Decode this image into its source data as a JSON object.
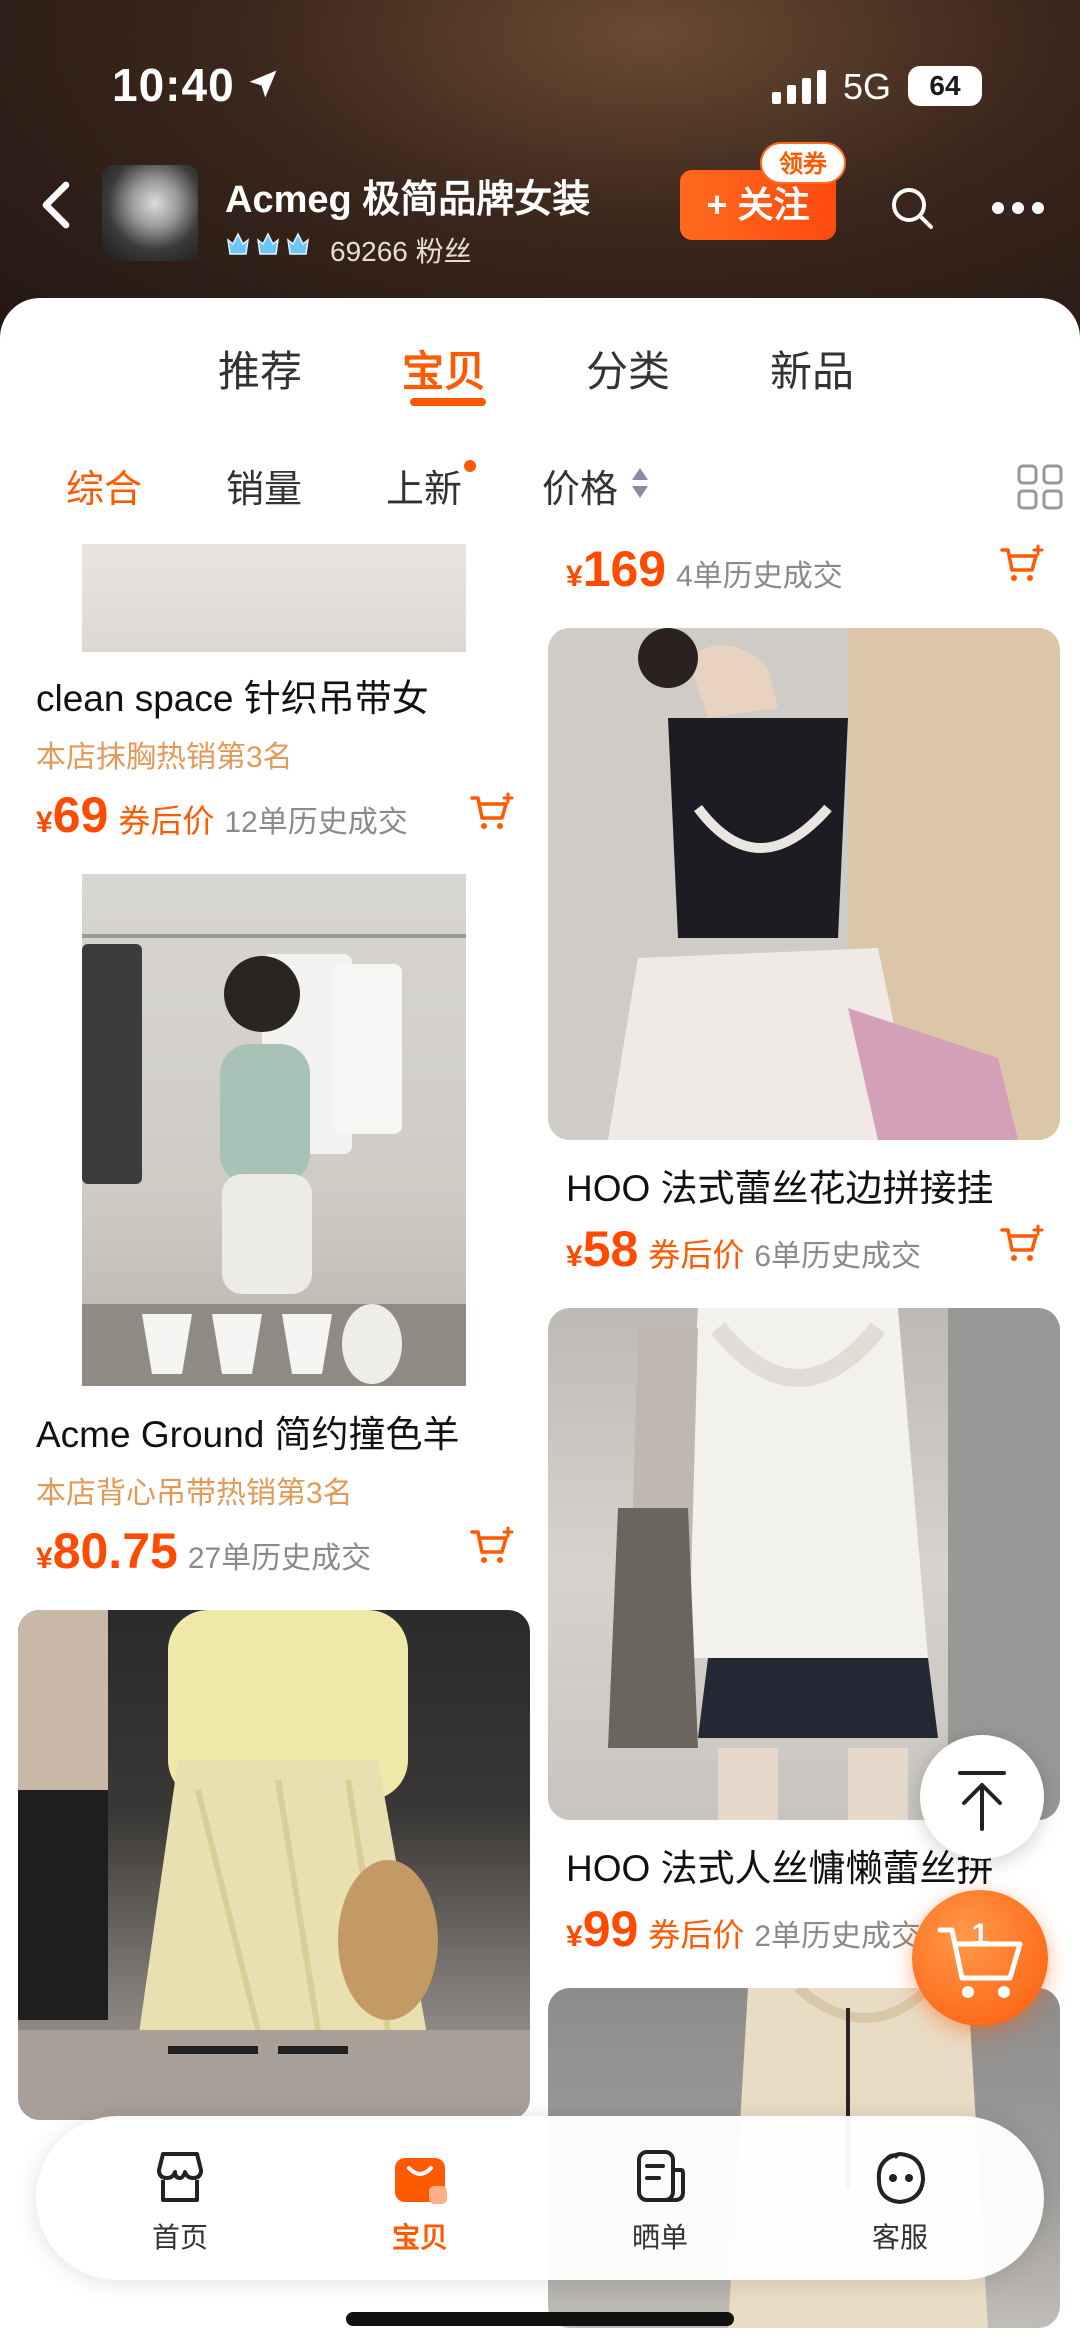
{
  "status_bar": {
    "time": "10:40",
    "network": "5G",
    "battery": "64"
  },
  "shop": {
    "name": "Acmeg 极简品牌女装",
    "fans": "69266 粉丝",
    "follow_label": "+ 关注",
    "coupon_label": "领券"
  },
  "tabs": [
    {
      "label": "推荐",
      "active": false
    },
    {
      "label": "宝贝",
      "active": true
    },
    {
      "label": "分类",
      "active": false
    },
    {
      "label": "新品",
      "active": false
    }
  ],
  "filters": [
    {
      "label": "综合",
      "active": true
    },
    {
      "label": "销量",
      "active": false
    },
    {
      "label": "上新",
      "active": false
    },
    {
      "label": "价格",
      "active": false
    }
  ],
  "products": {
    "top_right": {
      "currency": "¥",
      "price": "169",
      "sold": "4单历史成交"
    },
    "left_1": {
      "title": "clean space 针织吊带女",
      "rank": "本店抹胸热销第3名",
      "currency": "¥",
      "price": "69",
      "after_coupon": "券后价",
      "sold": "12单历史成交"
    },
    "right_1": {
      "title": "HOO 法式蕾丝花边拼接挂",
      "currency": "¥",
      "price": "58",
      "after_coupon": "券后价",
      "sold": "6单历史成交"
    },
    "left_2": {
      "title": "Acme Ground 简约撞色羊",
      "rank": "本店背心吊带热销第3名",
      "currency": "¥",
      "price": "80.75",
      "sold": "27单历史成交"
    },
    "right_2": {
      "title": "HOO 法式人丝慵懒蕾丝拼",
      "currency": "¥",
      "price": "99",
      "after_coupon": "券后价",
      "sold": "2单历史成交"
    }
  },
  "floating_cart": {
    "count": "1"
  },
  "bottom_nav": [
    {
      "label": "首页",
      "icon": "shop-home-icon",
      "active": false
    },
    {
      "label": "宝贝",
      "icon": "shopping-bag-icon",
      "active": true
    },
    {
      "label": "晒单",
      "icon": "review-icon",
      "active": false
    },
    {
      "label": "客服",
      "icon": "customer-service-icon",
      "active": false
    }
  ],
  "colors": {
    "accent": "#ff5a00",
    "header_bg": "#2a1b14",
    "rank_text": "#e29a58"
  }
}
